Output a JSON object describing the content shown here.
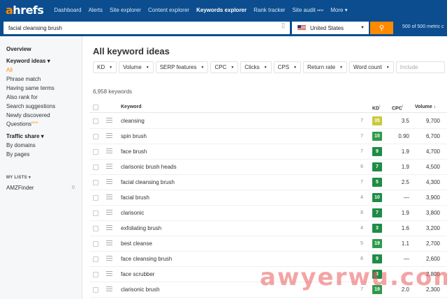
{
  "nav": {
    "logo_a": "a",
    "logo_rest": "hrefs",
    "items": [
      "Dashboard",
      "Alerts",
      "Site explorer",
      "Content explorer",
      "Keywords explorer",
      "Rank tracker",
      "Site audit",
      "More"
    ],
    "new_badge": "NEW",
    "more_caret": "▾"
  },
  "search": {
    "query": "facial cleansing brush",
    "country": "United States",
    "metrics_info": "500 of 500 metric c"
  },
  "sidebar": {
    "overview": "Overview",
    "keyword_ideas": "Keyword ideas ▾",
    "items": [
      "All",
      "Phrase match",
      "Having same terms",
      "Also rank for",
      "Search suggestions",
      "Newly discovered",
      "Questions"
    ],
    "new_badge": "NEW",
    "traffic_share": "Traffic share ▾",
    "traffic_items": [
      "By domains",
      "By pages"
    ],
    "my_lists": "MY LISTS ▾",
    "list_name": "AMZFinder",
    "list_count": "0"
  },
  "main": {
    "title": "All keyword ideas",
    "filters": [
      "KD",
      "Volume",
      "SERP features",
      "CPC",
      "Clicks",
      "CPS",
      "Return rate",
      "Word count"
    ],
    "include_placeholder": "Include",
    "keyword_count": "6,958 keywords"
  },
  "table": {
    "headers": {
      "keyword": "Keyword",
      "kd": "KD",
      "cpc": "CPC",
      "volume": "Volume ↓"
    },
    "rows": [
      {
        "keyword": "cleansing",
        "pos": "7",
        "kd": "35",
        "kd_color": "#c9c93a",
        "cpc": "3.5",
        "volume": "9,700"
      },
      {
        "keyword": "spin brush",
        "pos": "7",
        "kd": "15",
        "kd_color": "#2f9b4a",
        "cpc": "0.90",
        "volume": "6,700"
      },
      {
        "keyword": "face brush",
        "pos": "7",
        "kd": "9",
        "kd_color": "#1e8c46",
        "cpc": "1.9",
        "volume": "4,700"
      },
      {
        "keyword": "clarisonic brush heads",
        "pos": "6",
        "kd": "7",
        "kd_color": "#1e8c46",
        "cpc": "1.9",
        "volume": "4,500"
      },
      {
        "keyword": "facial cleansing brush",
        "pos": "7",
        "kd": "5",
        "kd_color": "#1e8c46",
        "cpc": "2.5",
        "volume": "4,300"
      },
      {
        "keyword": "facial brush",
        "pos": "4",
        "kd": "10",
        "kd_color": "#1e8c46",
        "cpc": "—",
        "volume": "3,900"
      },
      {
        "keyword": "clarisonic",
        "pos": "8",
        "kd": "7",
        "kd_color": "#1e8c46",
        "cpc": "1.9",
        "volume": "3,800"
      },
      {
        "keyword": "exfoliating brush",
        "pos": "4",
        "kd": "3",
        "kd_color": "#1e8c46",
        "cpc": "1.6",
        "volume": "3,200"
      },
      {
        "keyword": "best cleanse",
        "pos": "5",
        "kd": "19",
        "kd_color": "#2f9b4a",
        "cpc": "1.1",
        "volume": "2,700"
      },
      {
        "keyword": "face cleansing brush",
        "pos": "6",
        "kd": "9",
        "kd_color": "#1e8c46",
        "cpc": "—",
        "volume": "2,600"
      },
      {
        "keyword": "face scrubber",
        "pos": "",
        "kd": "3",
        "kd_color": "#1e8c46",
        "cpc": "",
        "volume": "2,800"
      },
      {
        "keyword": "clarisonic brush",
        "pos": "7",
        "kd": "19",
        "kd_color": "#2f9b4a",
        "cpc": "2.0",
        "volume": "2,300"
      }
    ]
  },
  "watermark": "awyerwu.com"
}
